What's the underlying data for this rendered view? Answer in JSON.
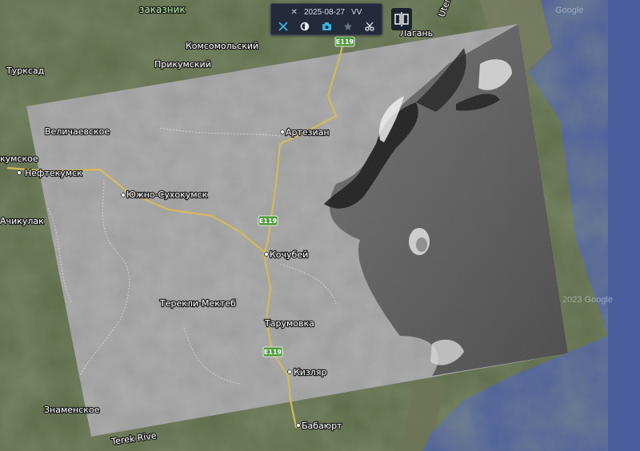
{
  "toolbar": {
    "date": "2025-08-27",
    "polarization": "VV",
    "buttons": [
      "tools-icon",
      "layers-icon",
      "camera-icon",
      "star-icon",
      "scissors-icon"
    ]
  },
  "split_button": "split-view-icon",
  "places": {
    "zakaznik": "заказник",
    "komsomolsky": "Комсомольский",
    "prikumsky": "Прикумский",
    "turksad": "Турксад",
    "velichaevskoe": "Величаевское",
    "kumskoe": "кумское",
    "neftekumsk": "Нефтекумск",
    "yuzhno_sukhokumsk": "Южно-Сухокумск",
    "achikulak": "Ачикулак",
    "artezian": "Артезиан",
    "kochubey": "Кочубей",
    "terekli_mekteb": "Терекли-Мектеб",
    "tarumovka": "Тарумовка",
    "kizlyar": "Кизляр",
    "znamenskoe": "Знаменское",
    "babayurt": "Бабаюрт",
    "lagan": "Лагань",
    "terek_river": "Terek Rive",
    "kalmyk_label": "Utemir"
  },
  "road_shields": [
    "E119",
    "E119",
    "E119"
  ],
  "watermarks": [
    "Google",
    "2023 Google"
  ],
  "colors": {
    "sea": "#4a5e9e",
    "land": "#5d6b4a",
    "road": "#d8b85a",
    "toolbar_bg": "#232a3a",
    "accent": "#39b5e0"
  }
}
